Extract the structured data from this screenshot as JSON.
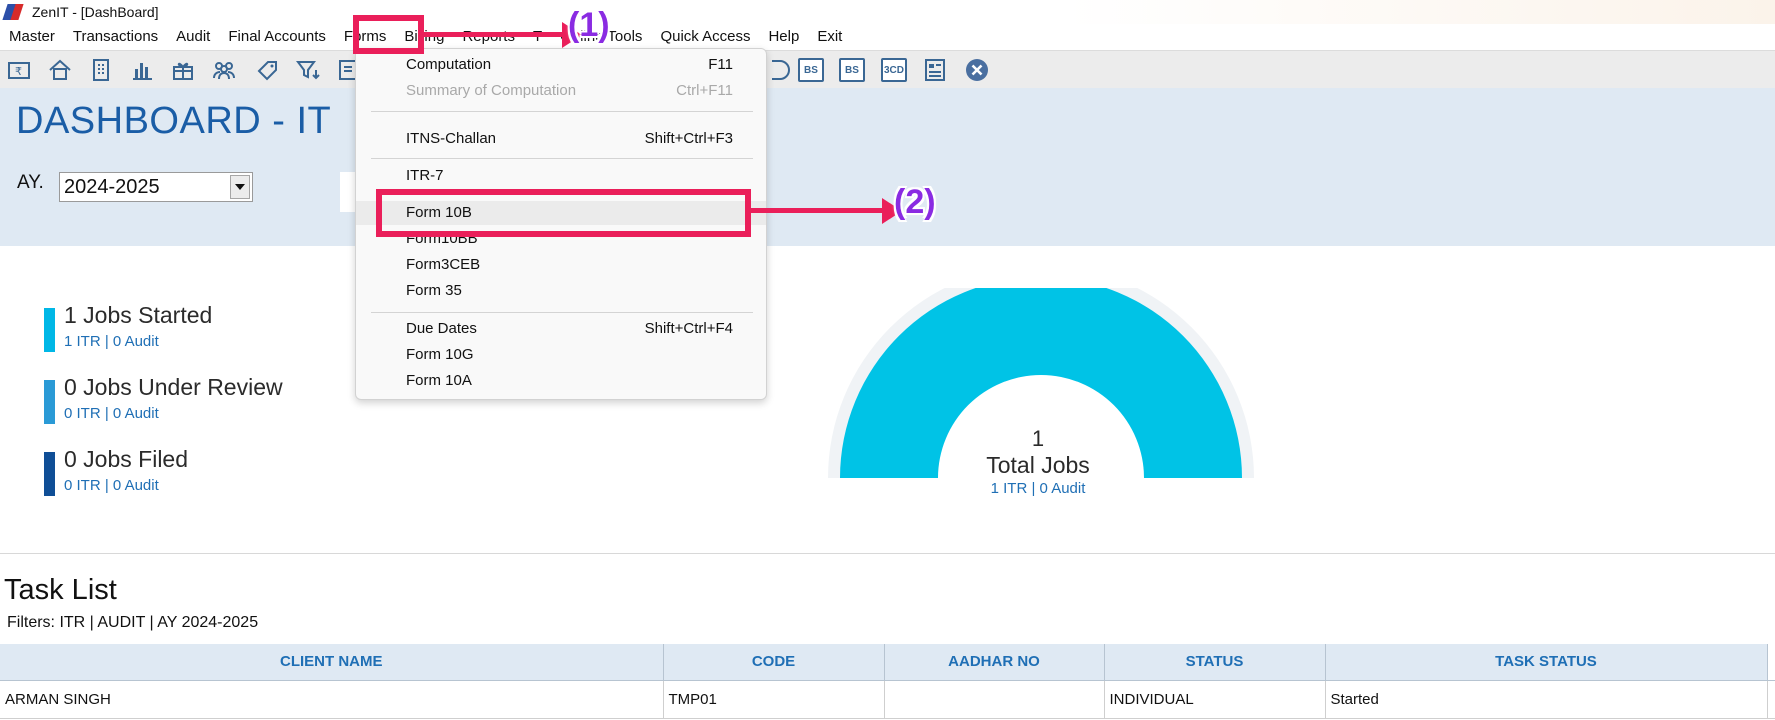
{
  "window": {
    "title": "ZenIT - [DashBoard]"
  },
  "menubar": {
    "items": [
      "Master",
      "Transactions",
      "Audit",
      "Final Accounts",
      "Forms",
      "Billing",
      "Reports",
      "T",
      "Online Tools",
      "Quick Access",
      "Help",
      "Exit"
    ]
  },
  "toolbar": {
    "icons": [
      "rupee-doc-icon",
      "home-icon",
      "building-icon",
      "bar-chart-icon",
      "gift-icon",
      "users-icon",
      "tag-icon",
      "filter-icon",
      "tax-icon",
      "pl-icon",
      "bs-icon",
      "bs-sch-icon",
      "3cd-icon",
      "form-icon",
      "close-circle-icon"
    ],
    "labels": {
      "bs": "BS",
      "bs_sch": "BS",
      "cd": "3CD"
    }
  },
  "dashboard": {
    "title": "DASHBOARD - IT",
    "ay_label": "AY.",
    "ay_value": "2024-2025"
  },
  "stats": [
    {
      "title": "1 Jobs Started",
      "sub": "1 ITR | 0 Audit",
      "color": "#00b7e6"
    },
    {
      "title": "0 Jobs Under Review",
      "sub": "0 ITR | 0 Audit",
      "color": "#2a9ad6"
    },
    {
      "title": "0 Jobs Filed",
      "sub": "0 ITR | 0 Audit",
      "color": "#0f4e96"
    }
  ],
  "gauge": {
    "value": "1",
    "label": "Total Jobs",
    "sub": "1 ITR | 0 Audit",
    "color": "#00c3e6",
    "fill_fraction": 1.0
  },
  "task_list": {
    "title": "Task List",
    "filters": "Filters: ITR | AUDIT | AY 2024-2025",
    "columns": [
      "CLIENT NAME",
      "CODE",
      "AADHAR NO",
      "STATUS",
      "TASK STATUS"
    ],
    "rows": [
      [
        "ARMAN SINGH",
        "TMP01",
        "",
        "INDIVIDUAL",
        "Started"
      ]
    ]
  },
  "forms_menu": {
    "items": [
      {
        "label": "Computation",
        "shortcut": "F11",
        "disabled": false
      },
      {
        "label": "Summary of Computation",
        "shortcut": "Ctrl+F11",
        "disabled": true
      },
      {
        "label": "ITNS-Challan",
        "shortcut": "Shift+Ctrl+F3",
        "disabled": false
      },
      {
        "label": "ITR-7",
        "shortcut": "",
        "disabled": false
      },
      {
        "label": "Form 10B",
        "shortcut": "",
        "disabled": false,
        "highlighted": true
      },
      {
        "label": "Form10BB",
        "shortcut": "",
        "disabled": false
      },
      {
        "label": "Form3CEB",
        "shortcut": "",
        "disabled": false
      },
      {
        "label": "Form 35",
        "shortcut": "",
        "disabled": false
      },
      {
        "label": "Due Dates",
        "shortcut": "Shift+Ctrl+F4",
        "disabled": false
      },
      {
        "label": "Form 10G",
        "shortcut": "",
        "disabled": false
      },
      {
        "label": "Form 10A",
        "shortcut": "",
        "disabled": false
      }
    ]
  },
  "annotations": {
    "step1": "(1)",
    "step2": "(2)",
    "color": "#ea1f5a"
  }
}
